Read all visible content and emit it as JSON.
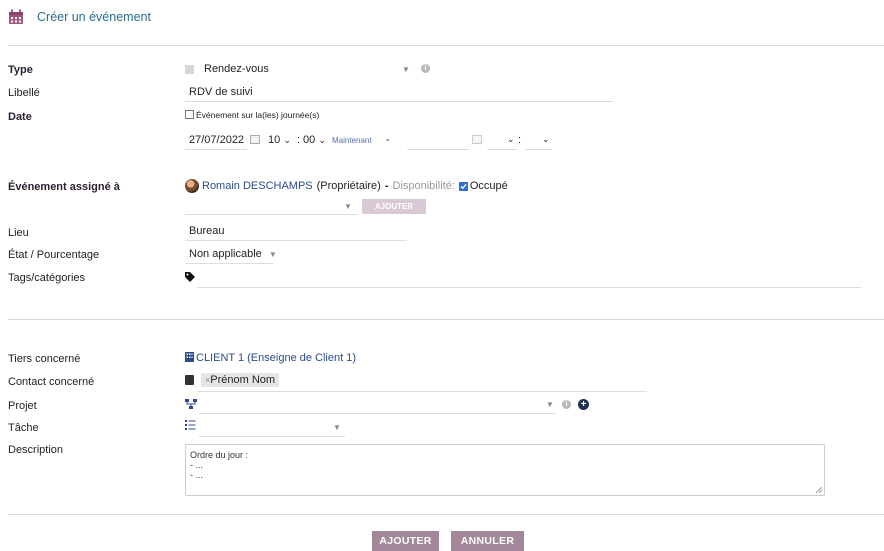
{
  "header": {
    "title": "Créer un événement"
  },
  "labels": {
    "type": "Type",
    "libelle": "Libellé",
    "date": "Date",
    "assigned": "Événement assigné à",
    "lieu": "Lieu",
    "etat": "État / Pourcentage",
    "tags": "Tags/catégories",
    "tiers": "Tiers concerné",
    "contact": "Contact concerné",
    "projet": "Projet",
    "tache": "Tâche",
    "description": "Description"
  },
  "form": {
    "type_value": "Rendez-vous",
    "libelle_value": "RDV de suivi",
    "allday_label": "Événement sur la(les) journée(s)",
    "date_start": "27/07/2022",
    "hour_start": "10",
    "minute_start": "00",
    "now_link": "Maintenant",
    "dash": "-",
    "colon": ":",
    "assigned_user": "Romain DESCHAMPS",
    "owner_tag": "(Propriétaire)",
    "owner_sep": "-",
    "availability_label": "Disponibilité:",
    "busy_label": "Occupé",
    "add_small_button": "AJOUTER",
    "lieu_value": "Bureau",
    "etat_value": "Non applicable",
    "tiers_value": "CLIENT 1 (Enseigne de Client 1)",
    "contact_value": "Prénom Nom",
    "contact_remove": "×",
    "description_lines": [
      "Ordre du jour :",
      "- ...",
      "- ..."
    ]
  },
  "footer": {
    "add_button": "AJOUTER",
    "cancel_button": "ANNULER"
  },
  "colors": {
    "accent": "#a3879b",
    "link": "#2b4b8a",
    "title": "#2b6d8a"
  }
}
